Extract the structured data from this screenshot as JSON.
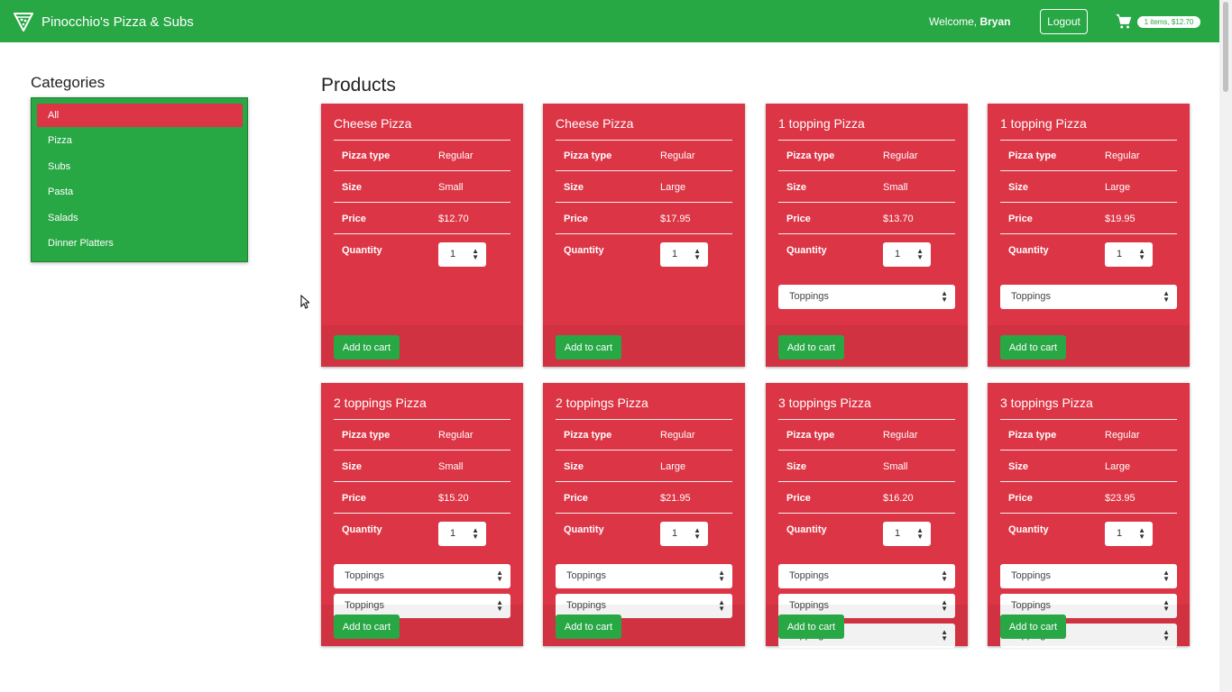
{
  "navbar": {
    "brand": "Pinocchio's Pizza & Subs",
    "welcome_prefix": "Welcome, ",
    "username": "Bryan",
    "logout_label": "Logout",
    "cart_badge": "1 items, $12.70",
    "icons": {
      "brand": "pizza-slice-icon",
      "cart": "cart-icon"
    }
  },
  "colors": {
    "primary_green": "#28a745",
    "product_red": "#dc3545"
  },
  "sidebar": {
    "title": "Categories",
    "items": [
      {
        "label": "All",
        "active": true
      },
      {
        "label": "Pizza",
        "active": false
      },
      {
        "label": "Subs",
        "active": false
      },
      {
        "label": "Pasta",
        "active": false
      },
      {
        "label": "Salads",
        "active": false
      },
      {
        "label": "Dinner Platters",
        "active": false
      }
    ]
  },
  "main": {
    "title": "Products",
    "labels": {
      "pizza_type": "Pizza type",
      "size": "Size",
      "price": "Price",
      "quantity": "Quantity"
    },
    "topping_placeholder": "Toppings",
    "add_to_cart_label": "Add to cart",
    "products": [
      {
        "name": "Cheese Pizza",
        "type": "Regular",
        "size": "Small",
        "price": "$12.70",
        "quantity": "1",
        "toppings": 0
      },
      {
        "name": "Cheese Pizza",
        "type": "Regular",
        "size": "Large",
        "price": "$17.95",
        "quantity": "1",
        "toppings": 0
      },
      {
        "name": "1 topping Pizza",
        "type": "Regular",
        "size": "Small",
        "price": "$13.70",
        "quantity": "1",
        "toppings": 1
      },
      {
        "name": "1 topping Pizza",
        "type": "Regular",
        "size": "Large",
        "price": "$19.95",
        "quantity": "1",
        "toppings": 1
      },
      {
        "name": "2 toppings Pizza",
        "type": "Regular",
        "size": "Small",
        "price": "$15.20",
        "quantity": "1",
        "toppings": 2
      },
      {
        "name": "2 toppings Pizza",
        "type": "Regular",
        "size": "Large",
        "price": "$21.95",
        "quantity": "1",
        "toppings": 2
      },
      {
        "name": "3 toppings Pizza",
        "type": "Regular",
        "size": "Small",
        "price": "$16.20",
        "quantity": "1",
        "toppings": 3
      },
      {
        "name": "3 toppings Pizza",
        "type": "Regular",
        "size": "Large",
        "price": "$23.95",
        "quantity": "1",
        "toppings": 3
      }
    ]
  }
}
